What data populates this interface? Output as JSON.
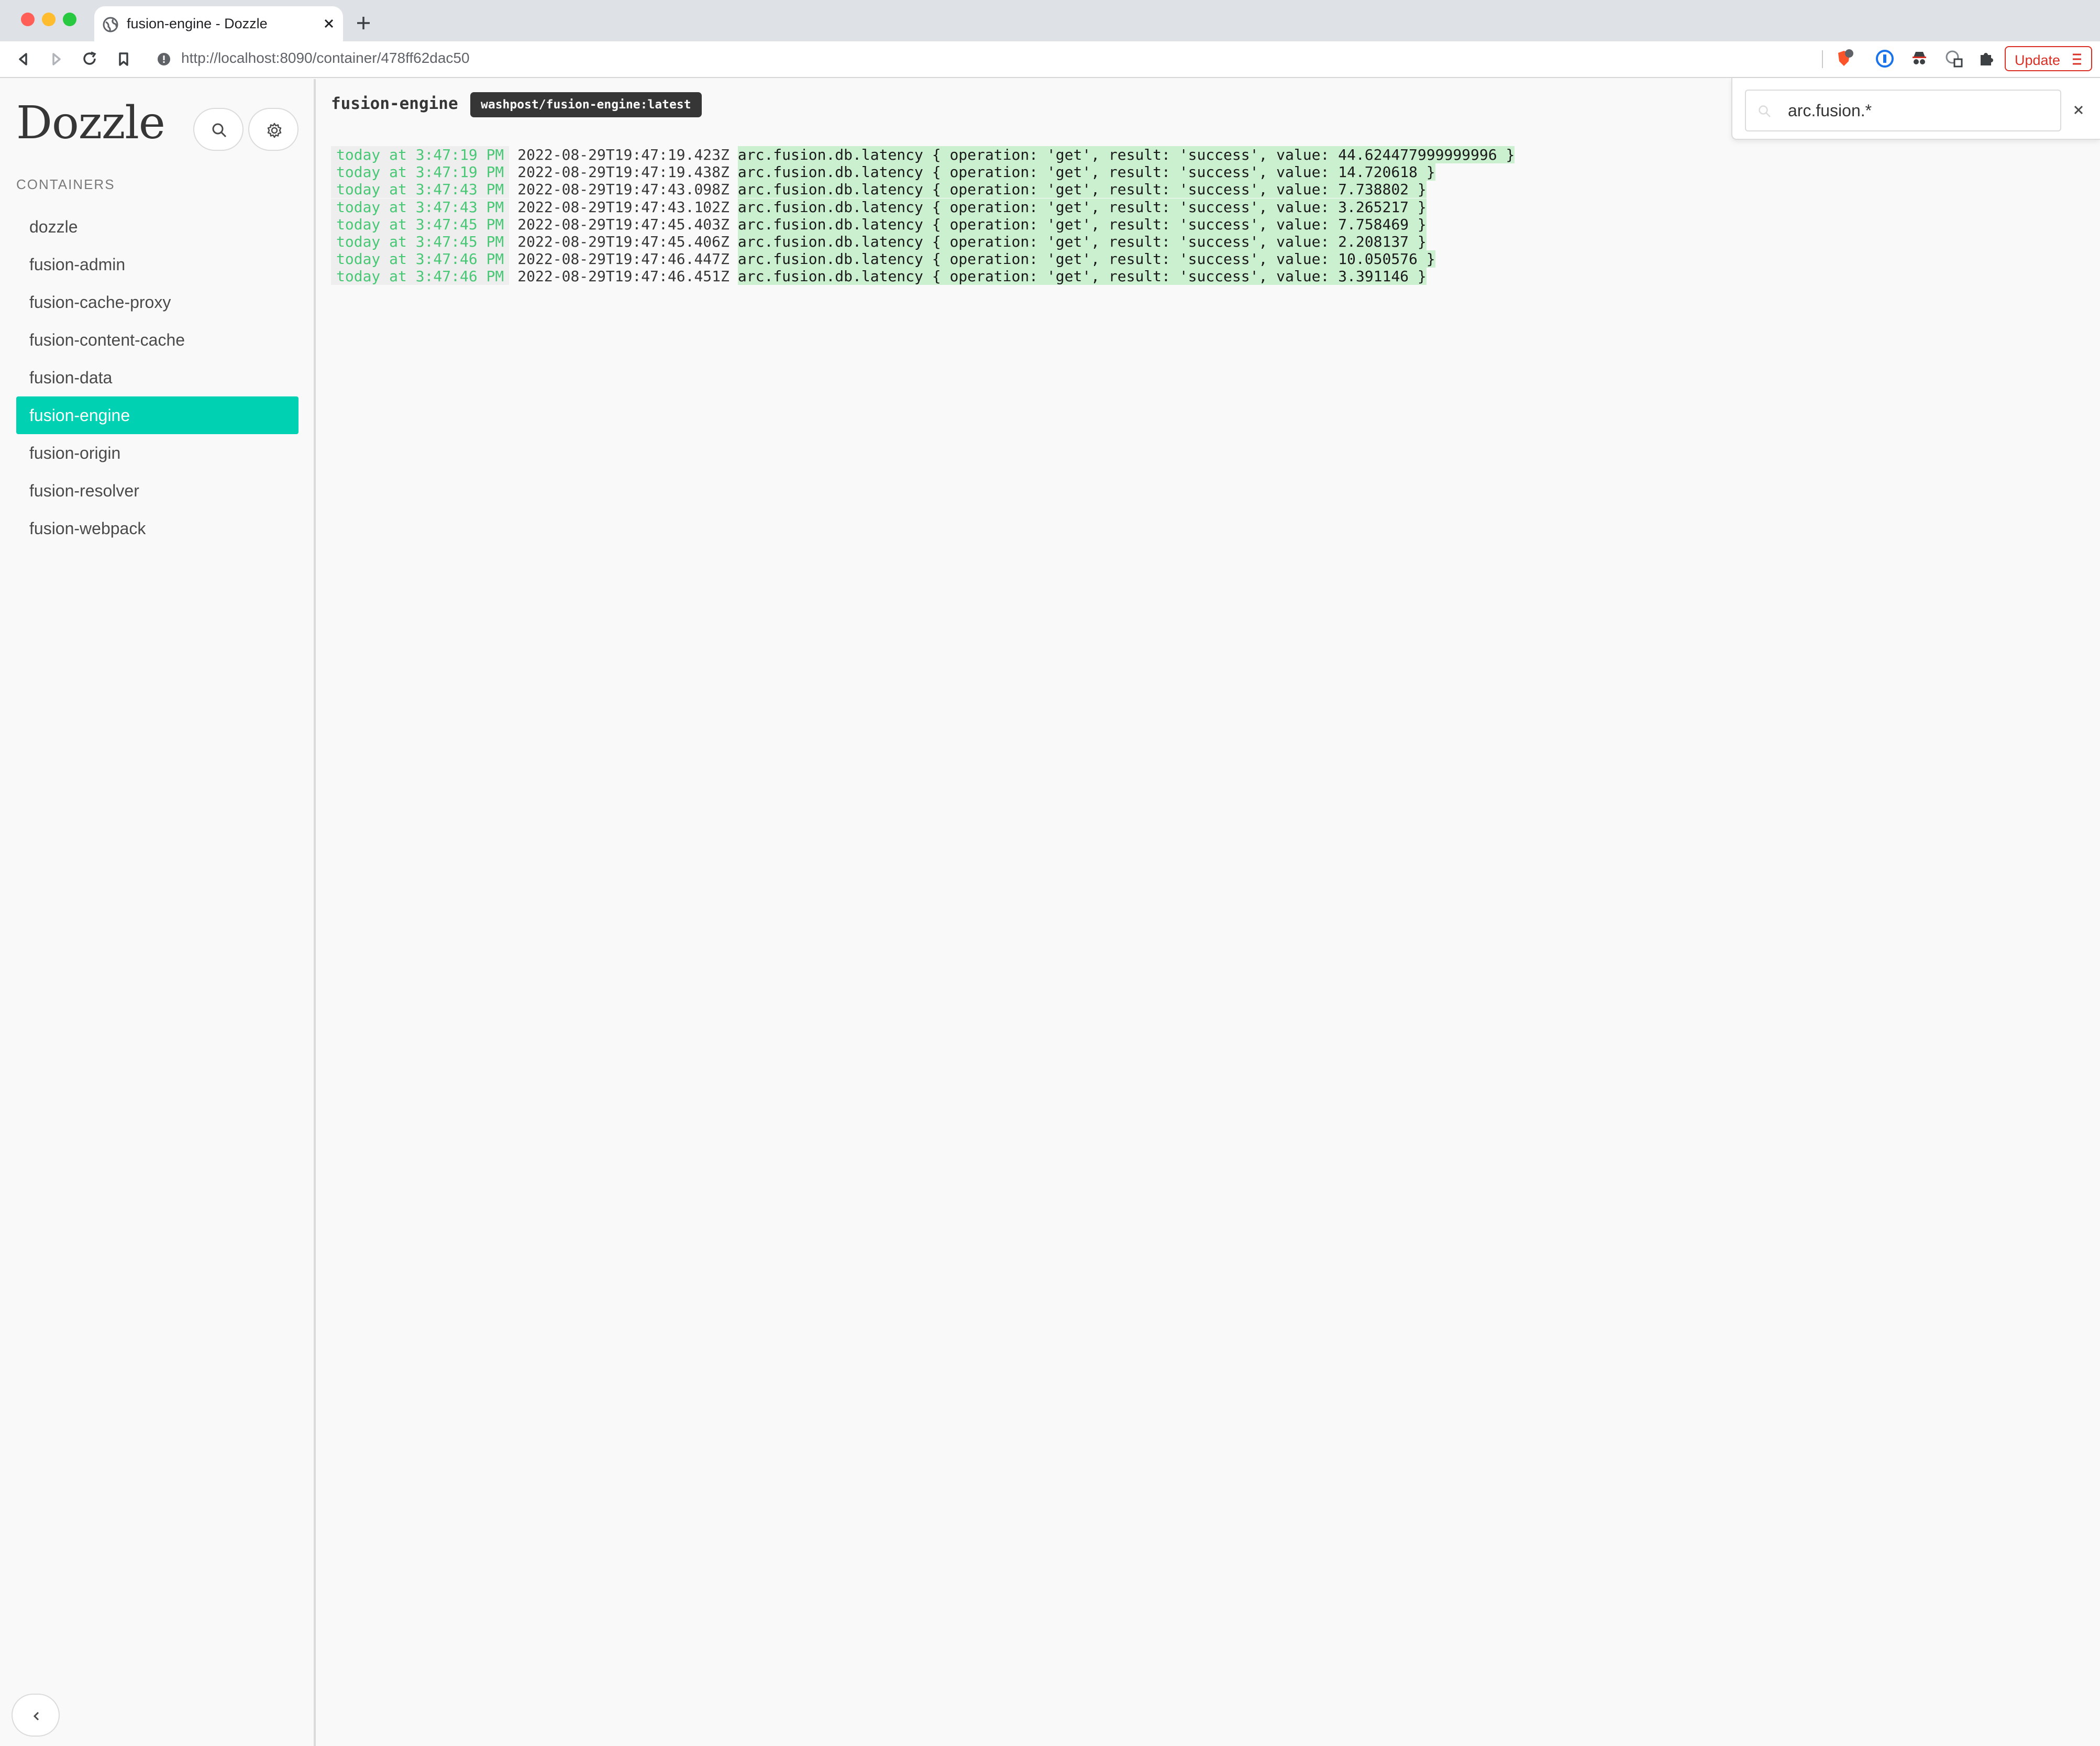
{
  "browser": {
    "tab_title": "fusion-engine - Dozzle",
    "url": "http://localhost:8090/container/478ff62dac50",
    "update_label": "Update",
    "traffic_colors": [
      "#ff5f57",
      "#febc2e",
      "#28c840"
    ]
  },
  "sidebar": {
    "logo": "Dozzle",
    "section_label": "CONTAINERS",
    "containers": [
      {
        "name": "dozzle",
        "active": false
      },
      {
        "name": "fusion-admin",
        "active": false
      },
      {
        "name": "fusion-cache-proxy",
        "active": false
      },
      {
        "name": "fusion-content-cache",
        "active": false
      },
      {
        "name": "fusion-data",
        "active": false
      },
      {
        "name": "fusion-engine",
        "active": true
      },
      {
        "name": "fusion-origin",
        "active": false
      },
      {
        "name": "fusion-resolver",
        "active": false
      },
      {
        "name": "fusion-webpack",
        "active": false
      }
    ],
    "accent_color": "#00d1b2"
  },
  "main": {
    "container_name": "fusion-engine",
    "image_tag": "washpost/fusion-engine:latest",
    "logs": [
      {
        "date": "today at 3:47:19 PM",
        "timestamp": "2022-08-29T19:47:19.423Z",
        "message": "arc.fusion.db.latency { operation: 'get', result: 'success', value: 44.624477999999996 }"
      },
      {
        "date": "today at 3:47:19 PM",
        "timestamp": "2022-08-29T19:47:19.438Z",
        "message": "arc.fusion.db.latency { operation: 'get', result: 'success', value: 14.720618 }"
      },
      {
        "date": "today at 3:47:43 PM",
        "timestamp": "2022-08-29T19:47:43.098Z",
        "message": "arc.fusion.db.latency { operation: 'get', result: 'success', value: 7.738802 }"
      },
      {
        "date": "today at 3:47:43 PM",
        "timestamp": "2022-08-29T19:47:43.102Z",
        "message": "arc.fusion.db.latency { operation: 'get', result: 'success', value: 3.265217 }"
      },
      {
        "date": "today at 3:47:45 PM",
        "timestamp": "2022-08-29T19:47:45.403Z",
        "message": "arc.fusion.db.latency { operation: 'get', result: 'success', value: 7.758469 }"
      },
      {
        "date": "today at 3:47:45 PM",
        "timestamp": "2022-08-29T19:47:45.406Z",
        "message": "arc.fusion.db.latency { operation: 'get', result: 'success', value: 2.208137 }"
      },
      {
        "date": "today at 3:47:46 PM",
        "timestamp": "2022-08-29T19:47:46.447Z",
        "message": "arc.fusion.db.latency { operation: 'get', result: 'success', value: 10.050576 }"
      },
      {
        "date": "today at 3:47:46 PM",
        "timestamp": "2022-08-29T19:47:46.451Z",
        "message": "arc.fusion.db.latency { operation: 'get', result: 'success', value: 3.391146 }"
      }
    ]
  },
  "search": {
    "value": "arc.fusion.*"
  },
  "icons": {
    "back": "back-arrow-icon",
    "forward": "forward-arrow-icon",
    "reload": "reload-icon",
    "bookmark": "bookmark-icon",
    "search": "search-icon",
    "settings": "gear-icon",
    "collapse": "chevron-left-icon",
    "close": "close-icon"
  }
}
